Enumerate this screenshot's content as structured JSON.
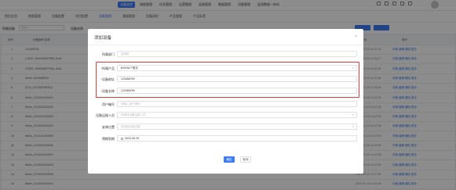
{
  "top_nav": {
    "items": [
      {
        "label": "设备监控",
        "active": true
      },
      {
        "label": "调度管理",
        "active": false
      },
      {
        "label": "任务管理",
        "active": false
      },
      {
        "label": "运营管理",
        "active": false
      },
      {
        "label": "运维管理",
        "active": false
      },
      {
        "label": "数据管理",
        "active": false
      },
      {
        "label": "设备管理",
        "active": false
      },
      {
        "label": "监测数据一体化",
        "active": false
      }
    ]
  },
  "sub_nav": {
    "items": [
      {
        "label": "首页总览",
        "active": false
      },
      {
        "label": "地图管理",
        "active": false
      },
      {
        "label": "设备配置",
        "active": false
      },
      {
        "label": "项目配置",
        "active": false
      },
      {
        "label": "设备管理",
        "active": true
      },
      {
        "label": "通道管理",
        "active": false
      },
      {
        "label": "设备巡检",
        "active": false
      },
      {
        "label": "产品管理",
        "active": false
      },
      {
        "label": "产品标签",
        "active": false
      }
    ]
  },
  "filter": {
    "label": "所属设备",
    "input_placeholder": "请输入",
    "label2": "设备名称"
  },
  "table": {
    "headers": [
      "序号",
      "设备编号/名称",
      "所属产品",
      "设备地址",
      "所属部门",
      "设备状态",
      "创建时间",
      "操作"
    ],
    "rows": [
      {
        "num": "1",
        "code": "123456789",
        "time": "2023-03-23 12:01:19",
        "ops": "详情  编辑  删除  更多"
      },
      {
        "num": "2",
        "code": "C3D57_5693984EF9B3_test2",
        "time": "2023-03-24 11:02:47",
        "ops": "详情  编辑  删除  更多"
      },
      {
        "num": "3",
        "code": "C3D57_5693984EF9B3_test1",
        "time": "2023-03-24 11:02:33",
        "ops": "详情  编辑  删除  更多"
      },
      {
        "num": "4",
        "code": "Meter_8416666001",
        "time": "2023-03-24 11:01:38",
        "ops": "详情  编辑  删除  更多"
      },
      {
        "num": "5",
        "code": "DT11_94C80976E9D3",
        "time": "2023-03-23 17:55:49",
        "ops": "详情  编辑  删除  更多"
      },
      {
        "num": "6",
        "code": "Meter_2103311403901",
        "time": "2023-03-20 14:47:05",
        "ops": "详情  编辑  删除  更多"
      },
      {
        "num": "7",
        "code": "Meter_2103311403902",
        "time": "2023-03-20 14:47:05",
        "ops": "详情  编辑  删除  更多"
      },
      {
        "num": "8",
        "code": "Meter_2103311403903",
        "time": "2023-03-20 14:47:05",
        "ops": "详情  编辑  删除  更多"
      },
      {
        "num": "9",
        "code": "Meter_2103311403904",
        "time": "2023-03-20 14:47:05",
        "ops": "详情  编辑  删除  更多"
      },
      {
        "num": "10",
        "code": "Meter_2103311403905",
        "time": "2023-03-20 14:47:05",
        "ops": "详情  编辑  删除  更多"
      },
      {
        "num": "11",
        "code": "Meter_2103311403906",
        "time": "2023-03-20 14:47:05",
        "ops": "详情  编辑  删除  更多"
      },
      {
        "num": "12",
        "code": "Meter_2103311403907",
        "time": "2023-03-20 14:47:05",
        "ops": "详情  编辑  删除  更多"
      },
      {
        "num": "13",
        "code": "Meter_2103311403908",
        "time": "2023-03-20 14:47:05",
        "ops": "详情  编辑  删除  更多"
      },
      {
        "num": "14",
        "code": "Meter_2103311403909",
        "time": "2023-03-20 14:47:05",
        "ops": "详情  编辑  删除  更多"
      },
      {
        "num": "15",
        "code": "Meter_2103311403910",
        "time": "2023-03-20 14:47:05",
        "ops": "详情  编辑  删除  更多"
      }
    ]
  },
  "modal": {
    "title": "添加设备",
    "close": "×",
    "fields": {
      "dept": {
        "label": "所属部门",
        "value": "请选择",
        "required": false
      },
      "product": {
        "label": "所属产品",
        "value": "BJKN677测试",
        "required": true
      },
      "address": {
        "label": "设备地址",
        "value": "123456789",
        "required": true
      },
      "name": {
        "label": "设备名称",
        "value": "123456789",
        "required": true
      },
      "user_code": {
        "label": "用户编号",
        "value": "请输入用户编号",
        "required": false
      },
      "maintainer": {
        "label": "设备运维人员",
        "value": "请选择设备运维人员",
        "required": false
      },
      "install": {
        "label": "安装位置",
        "value": "请选择安装位置",
        "required": false
      },
      "expire": {
        "label": "预期到期",
        "value": "2023-05-26",
        "required": false
      }
    },
    "ok_label": "确定",
    "cancel_label": "取消"
  },
  "colors": {
    "primary": "#3b7cf6",
    "highlight": "#e23a3a"
  }
}
